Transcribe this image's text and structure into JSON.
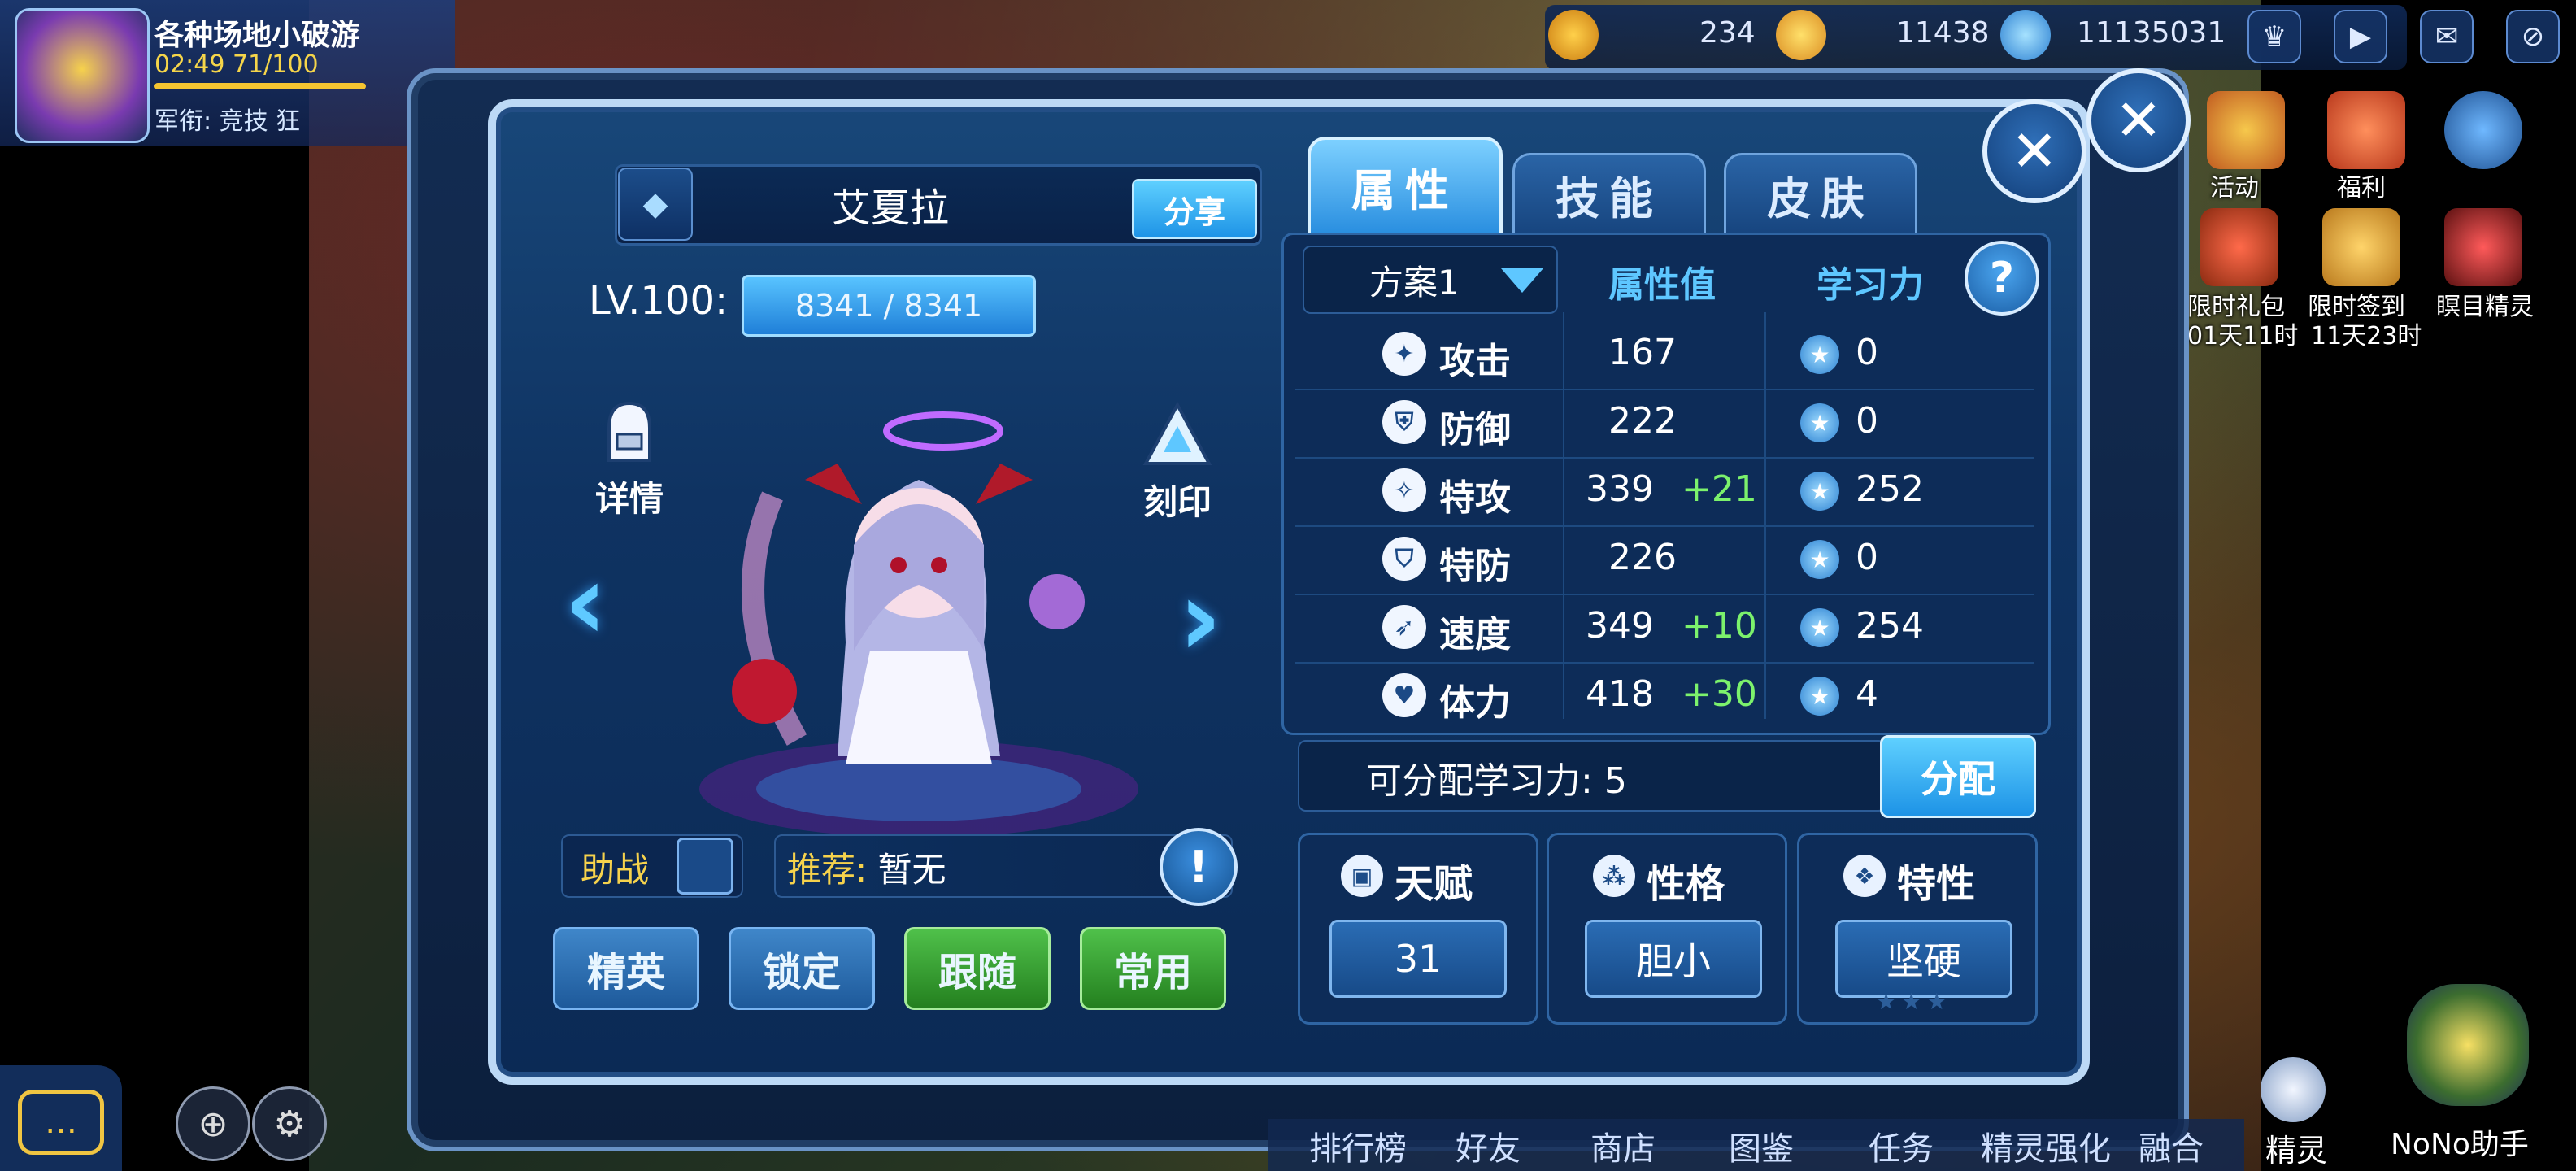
{
  "hud": {
    "player_name": "各种场地小破游",
    "energy": "02:49 71/100",
    "rank_line": "军衔:  竞技  狂",
    "currencies": [
      {
        "name": "coin-icon",
        "value": "234"
      },
      {
        "name": "gold-icon",
        "value": "11438"
      },
      {
        "name": "diamond-icon",
        "value": "11135031"
      }
    ],
    "right_buttons": [
      "trophy-icon",
      "play-icon",
      "mail-icon",
      "eye-off-icon"
    ]
  },
  "side": {
    "activity": "活动",
    "welfare": "福利",
    "limited_gift": "限时礼包",
    "limited_gift_time": "01天11时",
    "limited_signin": "限时签到",
    "limited_signin_time": "11天23时",
    "eye_pet": "瞑目精灵",
    "nono": "NoNo助手",
    "spirit": "精灵"
  },
  "dialog": {
    "pet_name": "艾夏拉",
    "share": "分享",
    "level": "LV.100:",
    "hp": "8341  /  8341",
    "details": "详情",
    "imprint": "刻印",
    "assist": "助战",
    "recommend_key": "推荐:",
    "recommend_val": "暂无",
    "buttons": {
      "elite": "精英",
      "lock": "锁定",
      "follow": "跟随",
      "common": "常用"
    },
    "tabs": {
      "attr": "属性",
      "skill": "技能",
      "skin": "皮肤"
    },
    "plan": "方案1",
    "col_attr": "属性值",
    "col_learn": "学习力",
    "stats": [
      {
        "name": "攻击",
        "value": "167",
        "bonus": "",
        "ev": "0"
      },
      {
        "name": "防御",
        "value": "222",
        "bonus": "",
        "ev": "0"
      },
      {
        "name": "特攻",
        "value": "339",
        "bonus": "+21",
        "ev": "252"
      },
      {
        "name": "特防",
        "value": "226",
        "bonus": "",
        "ev": "0"
      },
      {
        "name": "速度",
        "value": "349",
        "bonus": "+10",
        "ev": "254"
      },
      {
        "name": "体力",
        "value": "418",
        "bonus": "+30",
        "ev": "4"
      }
    ],
    "alloc_label": "可分配学习力:",
    "alloc_value": "5",
    "alloc_btn": "分配",
    "talent": "天赋",
    "talent_val": "31",
    "nature": "性格",
    "nature_val": "胆小",
    "trait": "特性",
    "trait_val": "坚硬"
  },
  "bottom_menu": [
    "排行榜",
    "好友",
    "商店",
    "图鉴",
    "任务",
    "精灵强化",
    "融合"
  ]
}
